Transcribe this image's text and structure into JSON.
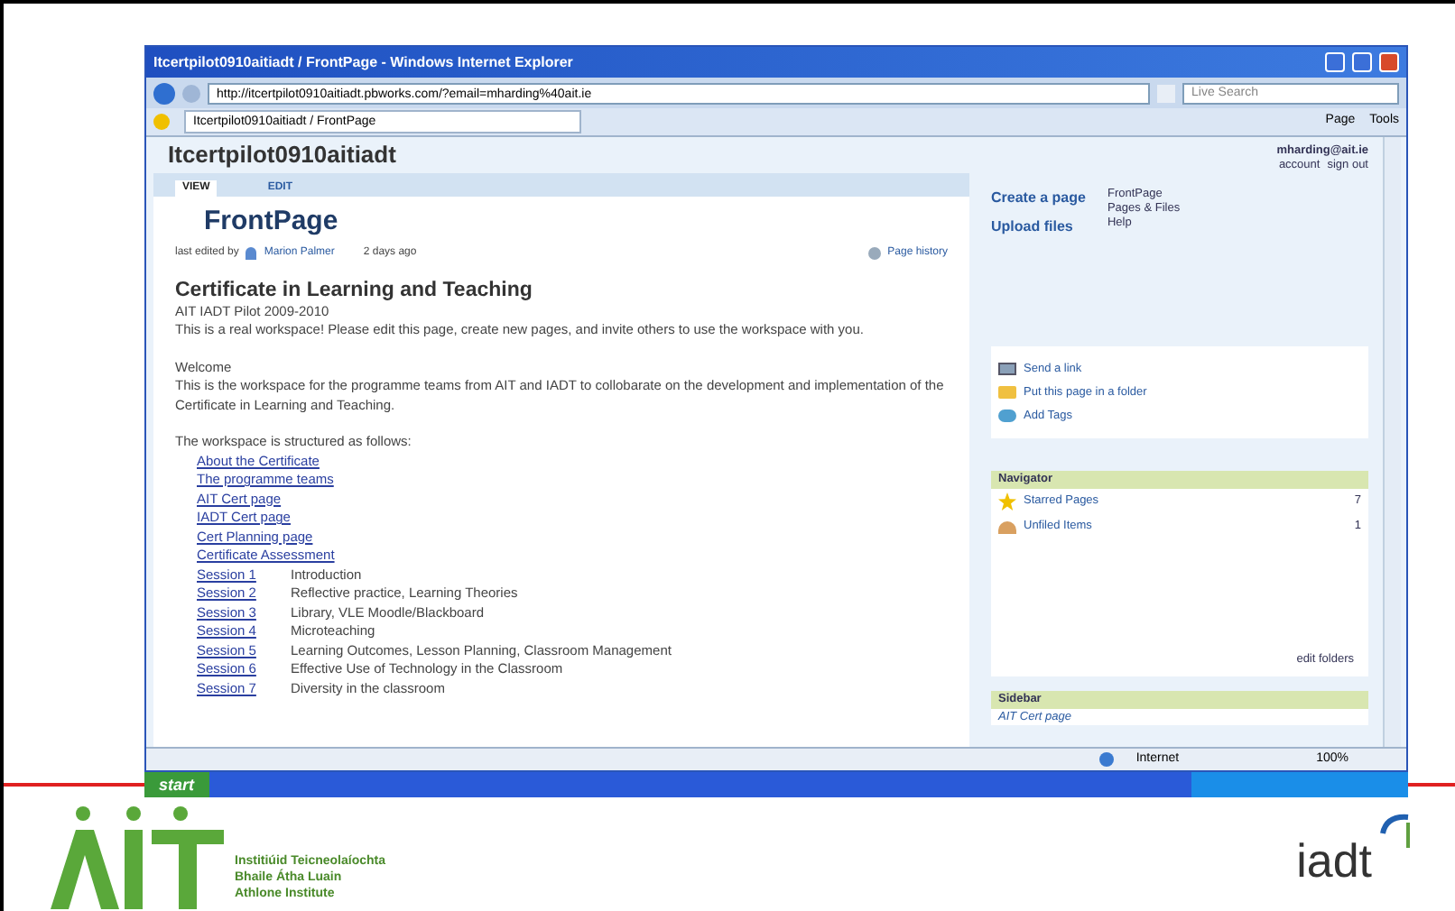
{
  "window": {
    "title": "Itcertpilot0910aitiadt / FrontPage - Windows Internet Explorer"
  },
  "address_bar": {
    "value": "http://itcertpilot0910aitiadt.pbworks.com/?email=mharding%40ait.ie",
    "search_placeholder": "Live Search"
  },
  "favorites_bar": {
    "tab": "Itcertpilot0910aitiadt / FrontPage",
    "tools": [
      "Page",
      "Tools"
    ]
  },
  "wiki": {
    "workspace": "Itcertpilot0910aitiadt",
    "user": "mharding@ait.ie",
    "user_links": [
      "account",
      "sign out"
    ],
    "tabs": [
      {
        "label": "VIEW",
        "selected": true
      },
      {
        "label": "EDIT",
        "selected": false
      }
    ],
    "page_title": "FrontPage",
    "edited_prefix": "last edited by",
    "editor": "Marion Palmer",
    "edited_when": "2 days ago",
    "history": "Page history",
    "heading": "Certificate in Learning and Teaching",
    "subtitle": "AIT IADT Pilot 2009-2010",
    "paragraphs": [
      "This is a real workspace!  Please edit this page, create new pages, and invite others to use the workspace with you.",
      "Welcome",
      "This is the workspace for the programme teams from AIT and IADT to collobarate on the development and implementation of the Certificate in Learning and Teaching.",
      "The workspace is structured as follows:"
    ],
    "links": [
      "About the Certificate",
      "The programme teams",
      "AIT Cert page",
      "IADT Cert page",
      "Cert Planning page",
      "Certificate Assessment"
    ],
    "sessions": [
      {
        "link": "Session 1",
        "topic": "Introduction"
      },
      {
        "link": "Session 2",
        "topic": "Reflective practice, Learning Theories"
      },
      {
        "link": "Session 3",
        "topic": "Library, VLE Moodle/Blackboard"
      },
      {
        "link": "Session 4",
        "topic": "Microteaching"
      },
      {
        "link": "Session 5",
        "topic": "Learning Outcomes, Lesson Planning, Classroom Management"
      },
      {
        "link": "Session 6",
        "topic": "Effective Use of Technology in the Classroom"
      },
      {
        "link": "Session 7",
        "topic": "Diversity in the classroom"
      }
    ]
  },
  "sidebar": {
    "actions": [
      "Create a page",
      "Upload files"
    ],
    "nav_links": [
      "FrontPage",
      "Pages & Files",
      "Help"
    ],
    "share": [
      {
        "kind": "mail",
        "label": "Send a link"
      },
      {
        "kind": "folder",
        "label": "Put this page in a folder"
      },
      {
        "kind": "tag",
        "label": "Add Tags"
      }
    ],
    "navigator": {
      "title": "Navigator",
      "items": [
        {
          "kind": "star",
          "label": "Starred Pages",
          "count": "7"
        },
        {
          "kind": "box",
          "label": "Unfiled Items",
          "count": "1"
        }
      ],
      "footer": "edit folders"
    },
    "sidebar_panel": {
      "title": "Sidebar",
      "item": "AIT Cert page"
    }
  },
  "status_bar": {
    "zone": "Internet",
    "zoom": "100%"
  },
  "taskbar": {
    "start": "start"
  },
  "logos": {
    "ait_lines": [
      "Institiúid Teicneolaíochta",
      "Bhaile Átha Luain",
      "Athlone Institute"
    ],
    "iadt": "iadt"
  }
}
